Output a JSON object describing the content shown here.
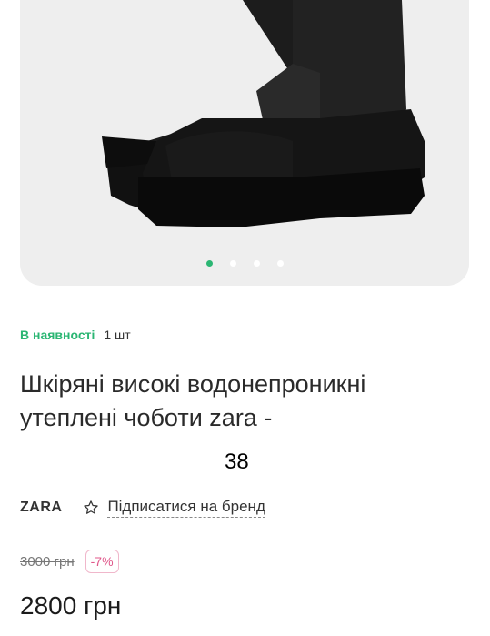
{
  "gallery": {
    "image_alt": "black-boots-photo",
    "dots_count": 4,
    "active_dot": 1
  },
  "stock": {
    "status": "В наявності",
    "quantity": "1 шт",
    "status_color": "#2bb673"
  },
  "product": {
    "title": "Шкіряні високі водонепроникні утеплені чоботи zara -",
    "size": "38"
  },
  "brand": {
    "name": "ZARA",
    "subscribe_label": "Підписатися на бренд",
    "subscribe_icon": "star-outline-icon"
  },
  "pricing": {
    "old_price": "3000 грн",
    "discount": "-7%",
    "price": "2800 грн",
    "discount_color": "#e0578a"
  }
}
